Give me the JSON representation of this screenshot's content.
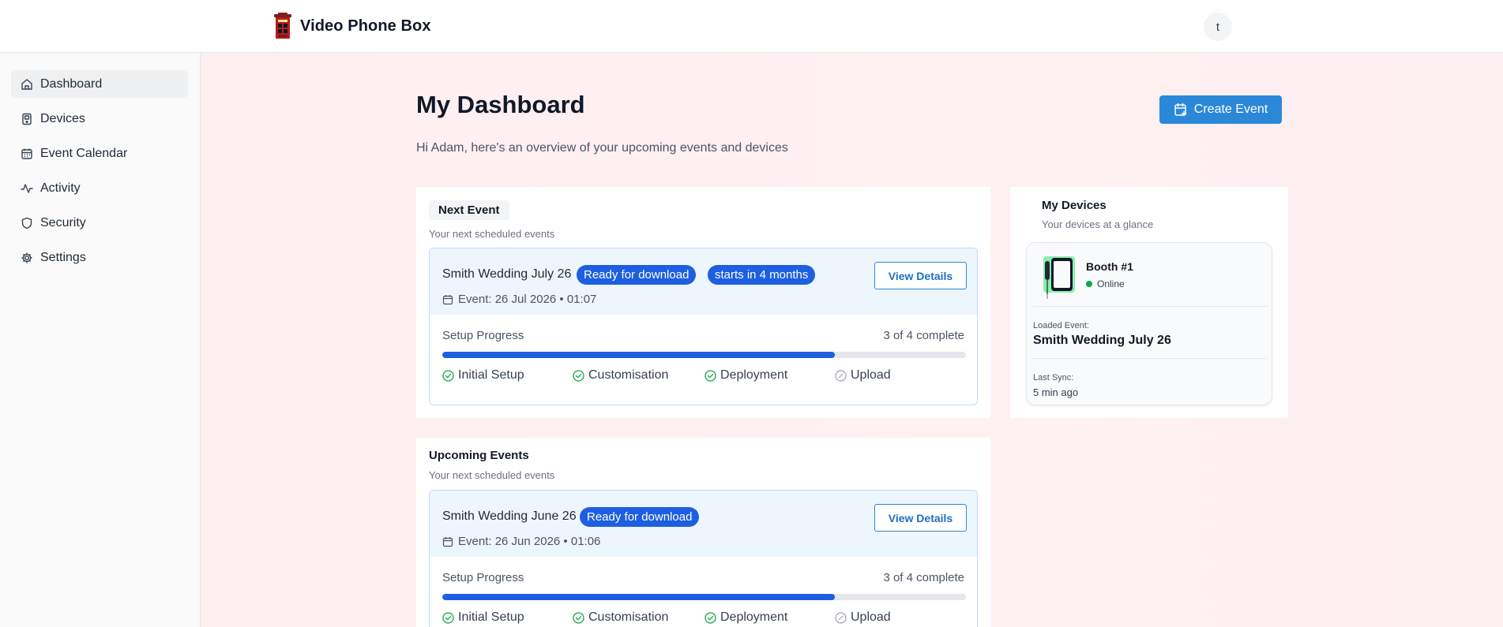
{
  "app": {
    "title": "Video Phone Box",
    "user_initial": "t"
  },
  "sidebar": {
    "items": [
      {
        "label": "Dashboard",
        "icon": "home-icon",
        "active": true
      },
      {
        "label": "Devices",
        "icon": "device-icon"
      },
      {
        "label": "Event Calendar",
        "icon": "calendar-icon"
      },
      {
        "label": "Activity",
        "icon": "activity-icon"
      },
      {
        "label": "Security",
        "icon": "shield-icon"
      },
      {
        "label": "Settings",
        "icon": "gear-icon"
      }
    ]
  },
  "page": {
    "title": "My Dashboard",
    "subtitle": "Hi Adam, here's an overview of your upcoming events and devices",
    "create_button": "Create Event"
  },
  "next_event": {
    "title": "Next Event",
    "subtitle": "Your next scheduled events",
    "event": {
      "name": "Smith Wedding July 26",
      "status_badge": "Ready for download",
      "time_badge": "starts in 4 months",
      "date": "Event: 26 Jul 2026 • 01:07",
      "details_button": "View Details",
      "setup_label": "Setup Progress",
      "setup_count": "3 of 4 complete",
      "progress": 0.75,
      "steps": [
        {
          "label": "Initial Setup",
          "done": true
        },
        {
          "label": "Customisation",
          "done": true
        },
        {
          "label": "Deployment",
          "done": true
        },
        {
          "label": "Upload",
          "done": false
        }
      ]
    }
  },
  "upcoming_events": {
    "title": "Upcoming Events",
    "subtitle": "Your next scheduled events",
    "event": {
      "name": "Smith Wedding June 26",
      "status_badge": "Ready for download",
      "date": "Event: 26 Jun 2026 • 01:06",
      "details_button": "View Details",
      "setup_label": "Setup Progress",
      "setup_count": "3 of 4 complete",
      "progress": 0.75,
      "steps": [
        {
          "label": "Initial Setup",
          "done": true
        },
        {
          "label": "Customisation",
          "done": true
        },
        {
          "label": "Deployment",
          "done": true
        },
        {
          "label": "Upload",
          "done": false
        }
      ]
    }
  },
  "devices": {
    "title": "My Devices",
    "subtitle": "Your devices at a glance",
    "device": {
      "name": "Booth #1",
      "status": "Online",
      "loaded_event_label": "Loaded Event:",
      "loaded_event": "Smith Wedding July 26",
      "last_sync_label": "Last Sync:",
      "last_sync": "5 min ago"
    }
  },
  "colors": {
    "primary": "#2b88d8",
    "badge": "#1d5fe0",
    "success": "#16a34a",
    "background_tint": "#fff1f2"
  }
}
